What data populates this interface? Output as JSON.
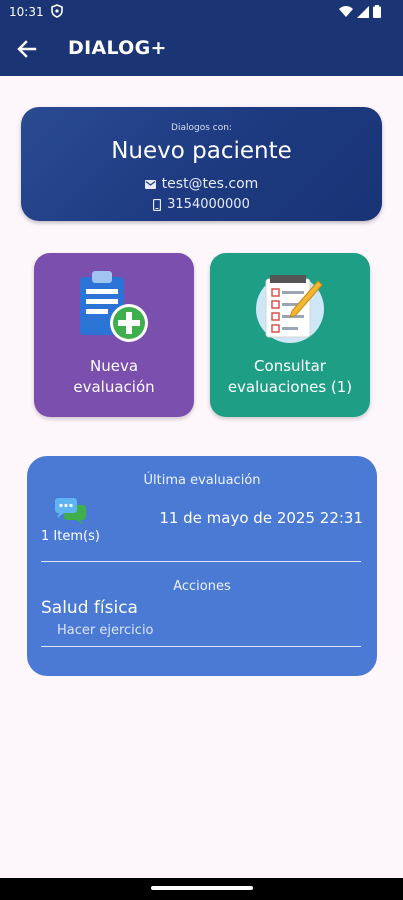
{
  "status_bar": {
    "time": "10:31"
  },
  "toolbar": {
    "title": "DIALOG+",
    "back_icon": "arrow-back-icon"
  },
  "patient": {
    "label": "Dialogos con:",
    "name": "Nuevo paciente",
    "email": "test@tes.com",
    "phone": "3154000000"
  },
  "actions": {
    "new_eval": {
      "label_1": "Nueva",
      "label_2": "evaluación",
      "color": "#7b4fae"
    },
    "consult": {
      "label_1": "Consultar",
      "label_2": "evaluaciones (1)",
      "color": "#1e9e84"
    }
  },
  "last_eval": {
    "heading": "Última evaluación",
    "items": "1 Item(s)",
    "date": "11 de mayo de 2025 22:31",
    "actions_heading": "Acciones",
    "category": "Salud física",
    "action": "Hacer ejercicio",
    "color": "#4a7ad3"
  },
  "colors": {
    "appbar": "#1b3474",
    "background": "#fdf7fc"
  }
}
